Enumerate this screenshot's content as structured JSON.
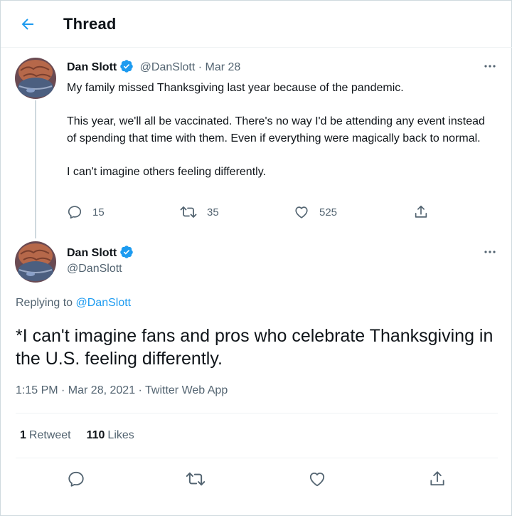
{
  "header": {
    "title": "Thread",
    "back_icon": "arrow-left-icon"
  },
  "colors": {
    "accent": "#1d9bf0",
    "muted": "#536471",
    "text": "#0f1419",
    "border": "#cfd9de"
  },
  "parent_tweet": {
    "author_name": "Dan Slott",
    "handle": "@DanSlott",
    "separator": "·",
    "date": "Mar 28",
    "paragraphs": [
      "My family missed Thanksgiving last year because of the pandemic.",
      "This year, we'll all be vaccinated. There's no way I'd be attending any event instead of spending that time with them. Even if everything were magically back to normal.",
      "I can't imagine others feeling differently."
    ],
    "replies": "15",
    "retweets": "35",
    "likes": "525"
  },
  "main_tweet": {
    "author_name": "Dan Slott",
    "handle": "@DanSlott",
    "replying_prefix": "Replying to",
    "replying_to": "@DanSlott",
    "text": "*I can't imagine fans and pros who celebrate Thanksgiving in the U.S. feeling differently.",
    "timestamp": "1:15 PM · Mar 28, 2021 · Twitter Web App",
    "retweet_count": "1",
    "retweet_label": "Retweet",
    "like_count": "110",
    "like_label": "Likes"
  }
}
